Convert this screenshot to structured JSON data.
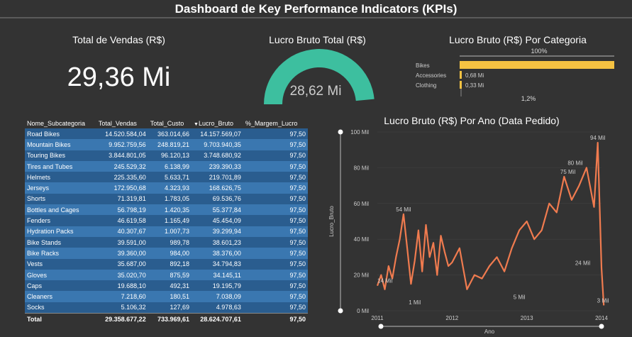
{
  "dashboard": {
    "title": "Dashboard de Key Performance Indicators (KPIs)"
  },
  "card_vendas": {
    "title": "Total de Vendas (R$)",
    "value": "29,36 Mi"
  },
  "card_lucro": {
    "title": "Lucro Bruto Total (R$)",
    "value": "28,62 Mi",
    "gauge_fraction": 0.97,
    "color": "#3dbf9f"
  },
  "card_categoria": {
    "title": "Lucro Bruto (R$) Por Categoria",
    "top_label": "100%",
    "bottom_label": "1,2%",
    "bar_color": "#f5c242"
  },
  "table": {
    "headers": [
      "Nome_Subcategoria",
      "Total_Vendas",
      "Total_Custo",
      "Lucro_Bruto",
      "%_Margem_Lucro"
    ],
    "rows": [
      [
        "Road Bikes",
        "14.520.584,04",
        "363.014,66",
        "14.157.569,07",
        "97,50"
      ],
      [
        "Mountain Bikes",
        "9.952.759,56",
        "248.819,21",
        "9.703.940,35",
        "97,50"
      ],
      [
        "Touring Bikes",
        "3.844.801,05",
        "96.120,13",
        "3.748.680,92",
        "97,50"
      ],
      [
        "Tires and Tubes",
        "245.529,32",
        "6.138,99",
        "239.390,33",
        "97,50"
      ],
      [
        "Helmets",
        "225.335,60",
        "5.633,71",
        "219.701,89",
        "97,50"
      ],
      [
        "Jerseys",
        "172.950,68",
        "4.323,93",
        "168.626,75",
        "97,50"
      ],
      [
        "Shorts",
        "71.319,81",
        "1.783,05",
        "69.536,76",
        "97,50"
      ],
      [
        "Bottles and Cages",
        "56.798,19",
        "1.420,35",
        "55.377,84",
        "97,50"
      ],
      [
        "Fenders",
        "46.619,58",
        "1.165,49",
        "45.454,09",
        "97,50"
      ],
      [
        "Hydration Packs",
        "40.307,67",
        "1.007,73",
        "39.299,94",
        "97,50"
      ],
      [
        "Bike Stands",
        "39.591,00",
        "989,78",
        "38.601,23",
        "97,50"
      ],
      [
        "Bike Racks",
        "39.360,00",
        "984,00",
        "38.376,00",
        "97,50"
      ],
      [
        "Vests",
        "35.687,00",
        "892,18",
        "34.794,83",
        "97,50"
      ],
      [
        "Gloves",
        "35.020,70",
        "875,59",
        "34.145,11",
        "97,50"
      ],
      [
        "Caps",
        "19.688,10",
        "492,31",
        "19.195,79",
        "97,50"
      ],
      [
        "Cleaners",
        "7.218,60",
        "180,51",
        "7.038,09",
        "97,50"
      ],
      [
        "Socks",
        "5.106,32",
        "127,69",
        "4.978,63",
        "97,50"
      ]
    ],
    "total": [
      "Total",
      "29.358.677,22",
      "733.969,61",
      "28.624.707,61",
      "97,50"
    ]
  },
  "chart_data": [
    {
      "type": "bar",
      "title": "Lucro Bruto (R$) Por Categoria",
      "categories": [
        "Bikes",
        "Accessories",
        "Clothing"
      ],
      "values": [
        100,
        0.68,
        0.33
      ],
      "value_labels": [
        "",
        "0,68 Mi",
        "0,33 Mi"
      ],
      "orientation": "horizontal"
    },
    {
      "type": "line",
      "title": "Lucro Bruto (R$) Por Ano (Data Pedido)",
      "xlabel": "Ano",
      "ylabel": "Lucro_Bruto",
      "xlim": [
        2011,
        2014
      ],
      "ylim": [
        0,
        100000
      ],
      "x_ticks": [
        "2011",
        "2012",
        "2013",
        "2014"
      ],
      "y_ticks": [
        "0 Mil",
        "20 Mil",
        "40 Mil",
        "60 Mil",
        "80 Mil",
        "100 Mil"
      ],
      "color": "#f07b4f",
      "annotations": [
        "14 Mil",
        "54 Mil",
        "1 Mil",
        "5 Mil",
        "75 Mil",
        "80 Mil",
        "94 Mil",
        "24 Mil",
        "3 Mil"
      ],
      "series": [
        {
          "x": [
            2011.0,
            2011.05,
            2011.1,
            2011.15,
            2011.2,
            2011.25,
            2011.3,
            2011.35,
            2011.4,
            2011.45,
            2011.5,
            2011.55,
            2011.6,
            2011.65,
            2011.7,
            2011.75,
            2011.8,
            2011.85,
            2011.9,
            2011.95,
            2012.0,
            2012.1,
            2012.2,
            2012.3,
            2012.4,
            2012.5,
            2012.6,
            2012.7,
            2012.8,
            2012.9,
            2013.0,
            2013.1,
            2013.2,
            2013.3,
            2013.4,
            2013.5,
            2013.6,
            2013.7,
            2013.8,
            2013.9,
            2013.95,
            2014.0,
            2014.03
          ],
          "y": [
            14000,
            20000,
            12000,
            25000,
            18000,
            30000,
            40000,
            54000,
            35000,
            15000,
            28000,
            45000,
            22000,
            48000,
            30000,
            38000,
            20000,
            42000,
            33000,
            25000,
            27000,
            35000,
            12000,
            20000,
            18000,
            25000,
            30000,
            22000,
            35000,
            45000,
            50000,
            40000,
            45000,
            60000,
            55000,
            75000,
            62000,
            70000,
            80000,
            58000,
            94000,
            24000,
            3000
          ]
        }
      ]
    }
  ]
}
